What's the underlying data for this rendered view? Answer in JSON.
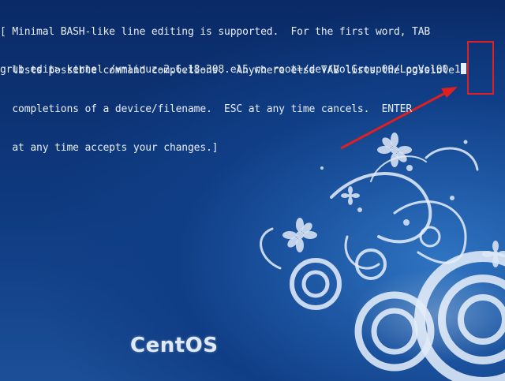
{
  "help_lines": [
    "[ Minimal BASH-like line editing is supported.  For the first word, TAB",
    "  lists possible command completions.  Anywhere else TAB lists the possible",
    "  completions of a device/filename.  ESC at any time cancels.  ENTER",
    "  at any time accepts your changes.]"
  ],
  "prompt": "grub edit>",
  "command": " kernel /vmlinuz-2.6.18-308.el5 ro root=/dev/VolGroup00/LogVol00 1",
  "logo_text": "CentOS",
  "colors": {
    "text": "#e8eef8",
    "highlight": "#e02020",
    "background": "#0d2f6e"
  }
}
